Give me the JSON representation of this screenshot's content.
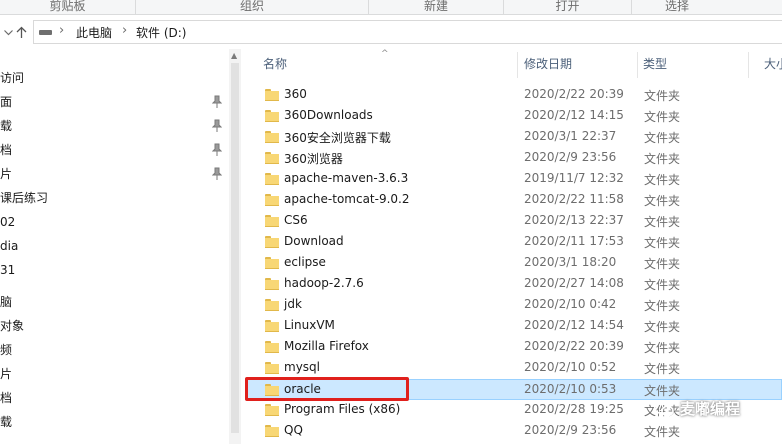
{
  "ribbon": {
    "groups": [
      "剪贴板",
      "组织",
      "新建",
      "打开",
      "选择"
    ]
  },
  "address": {
    "breadcrumb": [
      "此电脑",
      "软件 (D:)"
    ],
    "separator": "›",
    "back_icon": "back-arrow-icon",
    "up_icon": "up-arrow-icon",
    "recent_icon": "chevron-down-icon"
  },
  "sidebar": {
    "items": [
      {
        "label": "访问",
        "pinned": false
      },
      {
        "label": "面",
        "pinned": true
      },
      {
        "label": "载",
        "pinned": true
      },
      {
        "label": "档",
        "pinned": true
      },
      {
        "label": "片",
        "pinned": true
      },
      {
        "label": "课后练习",
        "pinned": false
      },
      {
        "label": "02",
        "pinned": false
      },
      {
        "label": "dia",
        "pinned": false
      },
      {
        "label": "31",
        "pinned": false
      },
      {
        "label": "脑",
        "pinned": false
      },
      {
        "label": "对象",
        "pinned": false
      },
      {
        "label": "频",
        "pinned": false
      },
      {
        "label": "片",
        "pinned": false
      },
      {
        "label": "档",
        "pinned": false
      },
      {
        "label": "载",
        "pinned": false
      }
    ]
  },
  "columns": {
    "name": "名称",
    "date": "修改日期",
    "type": "类型",
    "size": "大小"
  },
  "files": [
    {
      "name": "360",
      "date": "2020/2/22 20:39",
      "type": "文件夹"
    },
    {
      "name": "360Downloads",
      "date": "2020/2/12 14:15",
      "type": "文件夹"
    },
    {
      "name": "360安全浏览器下载",
      "date": "2020/3/1 22:37",
      "type": "文件夹"
    },
    {
      "name": "360浏览器",
      "date": "2020/2/9 23:56",
      "type": "文件夹"
    },
    {
      "name": "apache-maven-3.6.3",
      "date": "2019/11/7 12:32",
      "type": "文件夹"
    },
    {
      "name": "apache-tomcat-9.0.2",
      "date": "2020/2/22 11:58",
      "type": "文件夹"
    },
    {
      "name": "CS6",
      "date": "2020/2/13 22:37",
      "type": "文件夹"
    },
    {
      "name": "Download",
      "date": "2020/2/11 17:53",
      "type": "文件夹"
    },
    {
      "name": "eclipse",
      "date": "2020/3/1 18:20",
      "type": "文件夹"
    },
    {
      "name": "hadoop-2.7.6",
      "date": "2020/2/27 14:08",
      "type": "文件夹"
    },
    {
      "name": "jdk",
      "date": "2020/2/10 0:42",
      "type": "文件夹"
    },
    {
      "name": "LinuxVM",
      "date": "2020/2/12 14:54",
      "type": "文件夹"
    },
    {
      "name": "Mozilla Firefox",
      "date": "2020/2/22 20:39",
      "type": "文件夹"
    },
    {
      "name": "mysql",
      "date": "2020/2/10 0:52",
      "type": "文件夹"
    },
    {
      "name": "oracle",
      "date": "2020/2/10 0:53",
      "type": "文件夹",
      "selected": true
    },
    {
      "name": "Program Files (x86)",
      "date": "2020/2/28 19:25",
      "type": "文件夹"
    },
    {
      "name": "QQ",
      "date": "2020/2/9 23:56",
      "type": "文件夹"
    }
  ],
  "watermark": {
    "text": "麦嘟编程",
    "icon": "wechat-icon"
  },
  "colors": {
    "selection_bg": "#cce8ff",
    "selection_border": "#99d1ff",
    "highlight_box": "#e0201c",
    "folder": "#f8d775",
    "header_text": "#4c607a"
  }
}
